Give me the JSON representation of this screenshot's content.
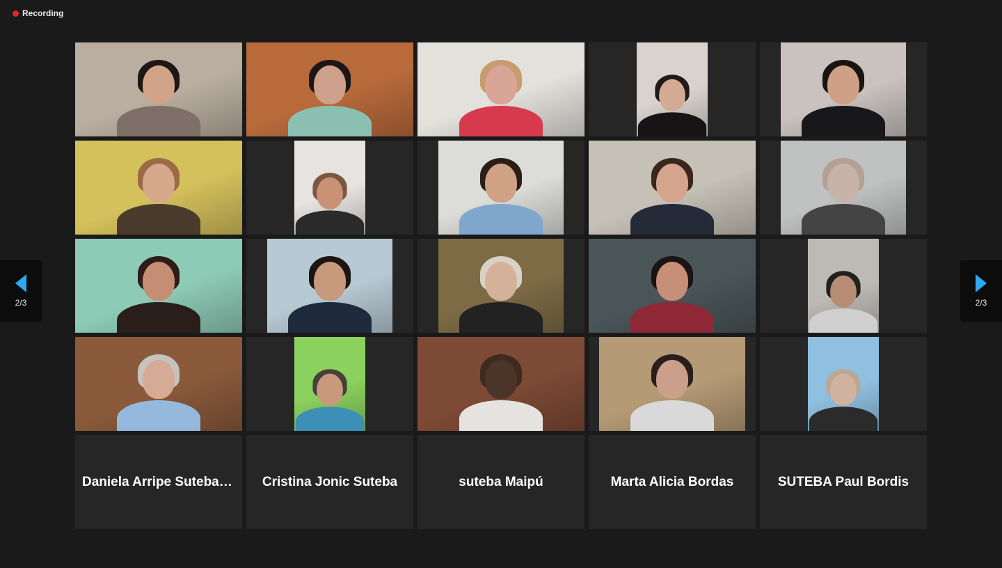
{
  "recording": {
    "label": "Recording",
    "indicator_color": "#e0242d"
  },
  "pagination": {
    "left_label": "2/3",
    "right_label": "2/3",
    "arrow_color": "#2ea8f0"
  },
  "video_tiles": [
    {
      "scene": "living room",
      "bg": "#b9aea0",
      "skin": "#d1a489",
      "hair": "#1d1715",
      "shirt": "#7f6f69"
    },
    {
      "scene": "orange wall window",
      "bg": "#b86a3b",
      "skin": "#cfa08c",
      "hair": "#1c1616",
      "shirt": "#8bbfb2"
    },
    {
      "scene": "white shelves",
      "bg": "#e3e1dc",
      "skin": "#d9a596",
      "hair": "#c79c6f",
      "shirt": "#d83a4d"
    },
    {
      "scene": "white wall",
      "bg": "#d8d3cf",
      "skin": "#d3aa94",
      "hair": "#201a18",
      "shirt": "#161414"
    },
    {
      "scene": "white wall",
      "bg": "#c9c2be",
      "skin": "#cf9f86",
      "hair": "#1a1412",
      "shirt": "#18181b"
    },
    {
      "scene": "yellow wall",
      "bg": "#d4c15c",
      "skin": "#d6a98c",
      "hair": "#9c6a45",
      "shirt": "#4b3b2d"
    },
    {
      "scene": "white wall",
      "bg": "#e6e3e0",
      "skin": "#c99276",
      "hair": "#7a5840",
      "shirt": "#2b2a2a"
    },
    {
      "scene": "office",
      "bg": "#dcdcd8",
      "skin": "#cfa286",
      "hair": "#2a1e17",
      "shirt": "#7fa7cc"
    },
    {
      "scene": "room with poster",
      "bg": "#c6c1b7",
      "skin": "#d4a58c",
      "hair": "#3a271b",
      "shirt": "#252a38"
    },
    {
      "scene": "bookshelf",
      "bg": "#bfc2c0",
      "skin": "#c7b3a7",
      "hair": "#b3a196",
      "shirt": "#444444"
    },
    {
      "scene": "teal wall bookshelf",
      "bg": "#8ecbb6",
      "skin": "#c58e74",
      "hair": "#2c1d17",
      "shirt": "#2a1e1a"
    },
    {
      "scene": "window",
      "bg": "#b7c9d3",
      "skin": "#c7997d",
      "hair": "#1b1612",
      "shirt": "#1f2a3c"
    },
    {
      "scene": "plants",
      "bg": "#7d6b45",
      "skin": "#d6b19a",
      "hair": "#d8d1c5",
      "shirt": "#222222"
    },
    {
      "scene": "teal room",
      "bg": "#4a5558",
      "skin": "#c78f77",
      "hair": "#1a1412",
      "shirt": "#8e2736"
    },
    {
      "scene": "white wall",
      "bg": "#bdbab6",
      "skin": "#b88c75",
      "hair": "#22201f",
      "shirt": "#cfcfcf"
    },
    {
      "scene": "wood ceiling",
      "bg": "#8a5a3b",
      "skin": "#d5ab98",
      "hair": "#c6c2bf",
      "shirt": "#95b9dd"
    },
    {
      "scene": "green curtain",
      "bg": "#8bd15e",
      "skin": "#c89a7b",
      "hair": "#474039",
      "shirt": "#3d8fb6"
    },
    {
      "scene": "brick wall",
      "bg": "#7d4a35",
      "skin": "#4b3428",
      "hair": "#3f2a20",
      "shirt": "#e6e2df"
    },
    {
      "scene": "ornate room",
      "bg": "#b59a76",
      "skin": "#caa08a",
      "hair": "#2a1f1a",
      "shirt": "#d9d9d9"
    },
    {
      "scene": "garden",
      "bg": "#8fc0e0",
      "skin": "#d0b39e",
      "hair": "#bba794",
      "shirt": "#2b2b2b"
    }
  ],
  "name_tiles": [
    {
      "name": "Daniela Arripe Suteba T..."
    },
    {
      "name": "Cristina Jonic Suteba"
    },
    {
      "name": "suteba Maipú"
    },
    {
      "name": "Marta Alicia Bordas"
    },
    {
      "name": "SUTEBA Paul Bordis"
    }
  ]
}
